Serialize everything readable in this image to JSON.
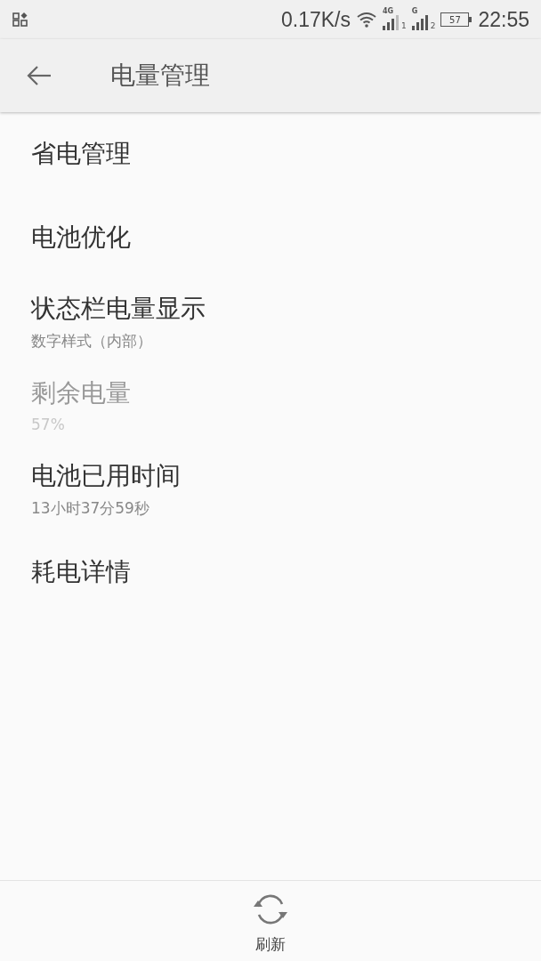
{
  "status_bar": {
    "net_speed": "0.17K/s",
    "sim_1": {
      "network": "4G",
      "slot": "1"
    },
    "sim_2": {
      "network": "G",
      "slot": "2"
    },
    "battery": "57",
    "time": "22:55"
  },
  "toolbar": {
    "title": "电量管理"
  },
  "items": [
    {
      "title": "省电管理",
      "disabled": false
    },
    {
      "title": "电池优化",
      "disabled": false
    },
    {
      "title": "状态栏电量显示",
      "subtitle": "数字样式（内部）",
      "disabled": false
    },
    {
      "title": "剩余电量",
      "subtitle": "57%",
      "disabled": true
    },
    {
      "title": "电池已用时间",
      "subtitle": "13小时37分59秒",
      "disabled": false
    },
    {
      "title": "耗电详情",
      "disabled": false
    }
  ],
  "bottom_bar": {
    "refresh": "刷新"
  }
}
